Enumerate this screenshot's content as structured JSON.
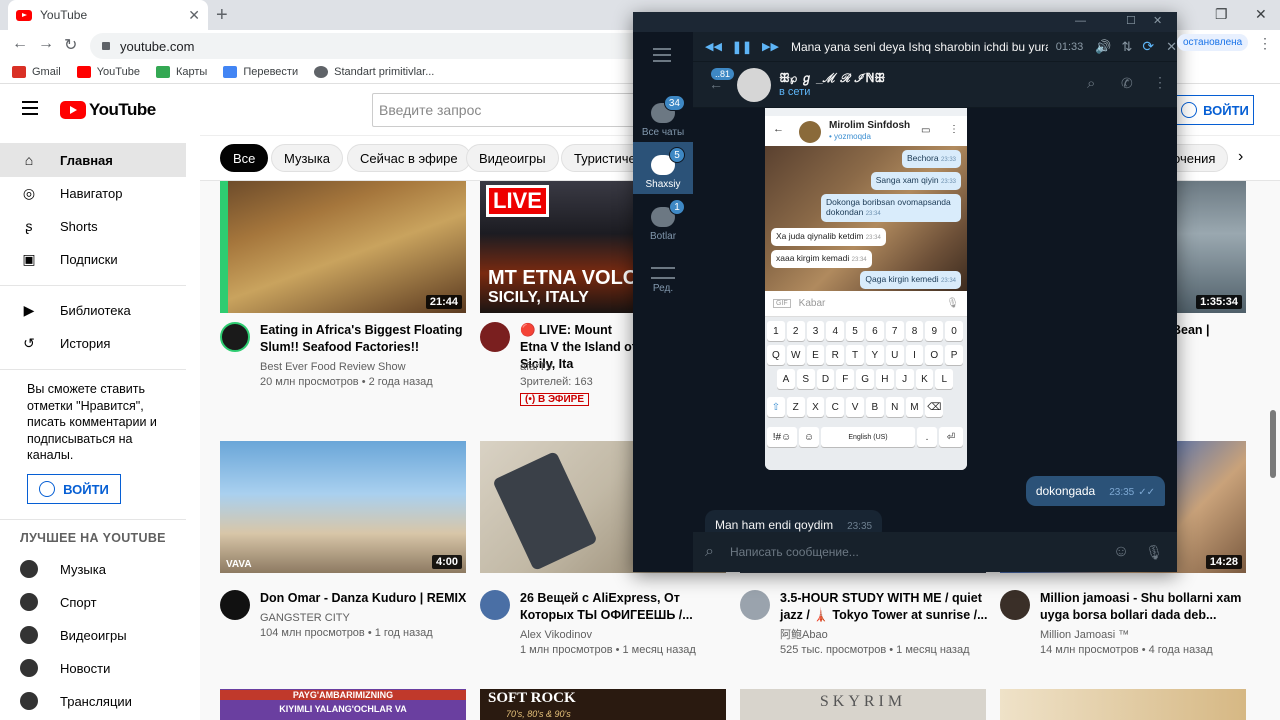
{
  "browser": {
    "tab_title": "YouTube",
    "url": "youtube.com",
    "bookmarks": [
      {
        "label": "Gmail",
        "color": "#d93025"
      },
      {
        "label": "YouTube",
        "color": "#ff0000"
      },
      {
        "label": "Карты",
        "color": "#34a853"
      },
      {
        "label": "Перевести",
        "color": "#4285f4"
      },
      {
        "label": "Standart primitivlar...",
        "color": "#5f6368"
      }
    ]
  },
  "youtube": {
    "logo": "YouTube",
    "search_placeholder": "Введите запрос",
    "signin_label": "ВОЙТИ",
    "sidebar": {
      "items": [
        {
          "label": "Главная",
          "icon": "home-icon"
        },
        {
          "label": "Навигатор",
          "icon": "compass-icon"
        },
        {
          "label": "Shorts",
          "icon": "shorts-icon"
        },
        {
          "label": "Подписки",
          "icon": "subscriptions-icon"
        },
        {
          "label": "Библиотека",
          "icon": "library-icon"
        },
        {
          "label": "История",
          "icon": "history-icon"
        }
      ],
      "note": "Вы сможете ставить отметки \"Нравится\", писать комментарии и подписываться на каналы.",
      "signin_label": "ВОЙТИ",
      "best_heading": "ЛУЧШЕЕ НА YOUTUBE",
      "best_items": [
        {
          "label": "Музыка"
        },
        {
          "label": "Спорт"
        },
        {
          "label": "Видеоигры"
        },
        {
          "label": "Новости"
        },
        {
          "label": "Трансляции"
        }
      ]
    },
    "chips": [
      "Все",
      "Музыка",
      "Сейчас в эфире",
      "Видеоигры",
      "Туристиче",
      "очения"
    ],
    "videos_row1": [
      {
        "title": "Eating in Africa's Biggest Floating Slum!! Seafood Factories!!",
        "channel": "Best Ever Food Review Show",
        "meta": "20 млн просмотров • 2 года назад",
        "duration": "21:44"
      },
      {
        "title": "🔴 LIVE: Mount Etna V the Island of Sicily, Ita",
        "channel": "afarTV",
        "meta": "Зрителей: 163",
        "badge": "(•) В ЭФИРЕ",
        "thumb_text1": "LIVE",
        "thumb_text2": "MT ETNA VOLC",
        "thumb_text3": "SICILY, ITALY"
      },
      {
        "title": "Bean |",
        "channel": "",
        "meta": "",
        "duration": "1:35:34"
      }
    ],
    "videos_row2": [
      {
        "title": "Don Omar - Danza Kuduro | REMIX",
        "channel": "GANGSTER CITY",
        "meta": "104 млн просмотров • 1 год назад",
        "duration": "4:00",
        "thumb_logo": "VAVA"
      },
      {
        "title": "26 Вещей с AliExpress, От Которых ТЫ ОФИГЕЕШЬ /...",
        "channel": "Alex Vikodinov",
        "meta": "1 млн просмотров • 1 месяц назад"
      },
      {
        "title": "3.5-HOUR STUDY WITH ME / quiet jazz / 🗼 Tokyo Tower at sunrise /...",
        "channel": "阿鲍Abao",
        "meta": "525 тыс. просмотров • 1 месяц назад"
      },
      {
        "title": "Million jamoasi - Shu bollarni xam uyga borsa bollari dada deb...",
        "channel": "Million Jamoasi ™",
        "meta": "14 млн просмотров • 4 года назад",
        "duration": "14:28"
      }
    ],
    "row3_texts": [
      "PAYG'AMBARIMIZNING",
      "KIYIMLI YALANG'OCHLAR VA",
      "SOFT ROCK",
      "70's, 80's & 90's",
      "SKYRIM"
    ]
  },
  "telegram": {
    "rail": [
      {
        "label": "Все чаты",
        "badge": "34"
      },
      {
        "label": "Shaxsiy",
        "badge": "5"
      },
      {
        "label": "Botlar",
        "badge": "1"
      },
      {
        "label": "Ред.",
        "badge": ""
      }
    ],
    "player_title": "Mana yana seni deya  Ishq sharobin ichdi bu yurak",
    "player_time": "01:33",
    "edge_text": "остановлена",
    "chat_name": "ꕥ℘ ℊ _ℳ ℛ ℐℕꕥ",
    "chat_status": "в сети",
    "back_badge": "..81",
    "phone": {
      "contact": "Mirolim Sinfdosh",
      "contact_status": "• yozmoqda",
      "bubbles": [
        {
          "dir": "out",
          "text": "Bechora",
          "time": "23:33"
        },
        {
          "dir": "out",
          "text": "Sanga xam qiyin",
          "time": "23:33"
        },
        {
          "dir": "out",
          "text": "Dokonga boribsan ovomapsanda dokondan",
          "time": "23:34"
        },
        {
          "dir": "in",
          "text": "Xa juda qiynalib ketdim",
          "time": "23:34"
        },
        {
          "dir": "in",
          "text": "xaaa kirgim kemadi",
          "time": "23:34"
        },
        {
          "dir": "out",
          "text": "Qaga kirgin kemedi",
          "time": "23:34"
        }
      ],
      "input_placeholder": "Kabar",
      "keys_row0": [
        "1",
        "2",
        "3",
        "4",
        "5",
        "6",
        "7",
        "8",
        "9",
        "0"
      ],
      "keys_row1": [
        "Q",
        "W",
        "E",
        "R",
        "T",
        "Y",
        "U",
        "I",
        "O",
        "P"
      ],
      "keys_row2": [
        "A",
        "S",
        "D",
        "F",
        "G",
        "H",
        "J",
        "K",
        "L"
      ],
      "keys_row3": [
        "⇧",
        "Z",
        "X",
        "C",
        "V",
        "B",
        "N",
        "M",
        "⌫"
      ],
      "space_label": "English (US)"
    },
    "messages": [
      {
        "dir": "out",
        "text": "dokongada",
        "time": "23:35"
      },
      {
        "dir": "in",
        "text": "Man ham endi qoydim",
        "time": "23:35"
      }
    ],
    "composer_placeholder": "Написать сообщение..."
  }
}
